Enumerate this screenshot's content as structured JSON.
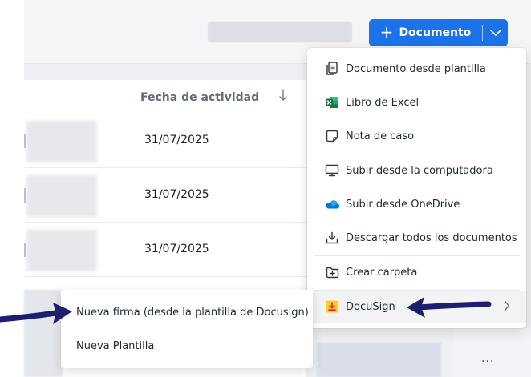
{
  "header": {
    "new_document_button": "Documento",
    "plus_symbol": "+"
  },
  "table": {
    "columns": [
      {
        "label": "Fecha de actividad",
        "sort": "descending"
      }
    ],
    "rows": [
      {
        "date": "31/07/2025"
      },
      {
        "date": "31/07/2025"
      },
      {
        "date": "31/07/2025"
      }
    ]
  },
  "row_actions_label": "...",
  "dropdown_menu": {
    "items": [
      {
        "label": "Documento desde plantilla",
        "icon": "document-template-icon"
      },
      {
        "label": "Libro de Excel",
        "icon": "excel-icon"
      },
      {
        "label": "Nota de caso",
        "icon": "note-icon"
      },
      {
        "label": "Subir desde la computadora",
        "icon": "monitor-icon"
      },
      {
        "label": "Subir desde OneDrive",
        "icon": "onedrive-icon"
      },
      {
        "label": "Descargar todos los documentos",
        "icon": "download-icon"
      },
      {
        "label": "Crear carpeta",
        "icon": "folder-plus-icon"
      },
      {
        "label": "DocuSign",
        "icon": "docusign-icon",
        "has_submenu": true,
        "highlighted": true
      }
    ]
  },
  "docusign_submenu": {
    "items": [
      {
        "label": "Nueva firma (desde la plantilla de Docusign)"
      },
      {
        "label": "Nueva Plantilla"
      }
    ]
  },
  "colors": {
    "primary": "#1a73e8",
    "arrow": "#1b1f6e",
    "excel_green": "#1e7145",
    "onedrive_blue": "#0078d4",
    "docusign_yellow": "#ffcc22",
    "docusign_red": "#d32f2f"
  }
}
